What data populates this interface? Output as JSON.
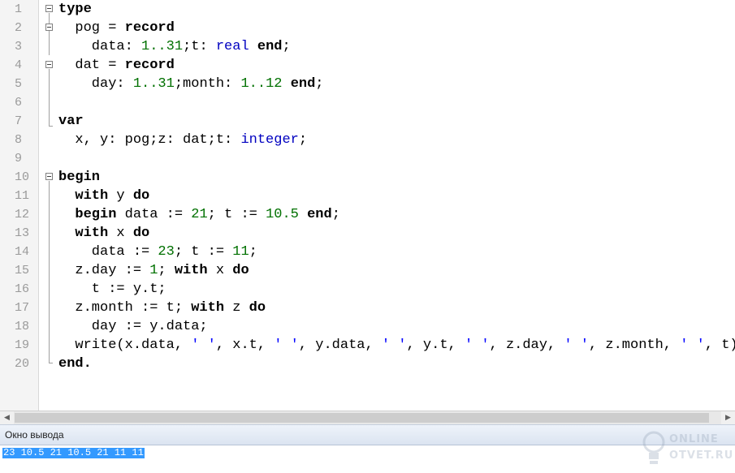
{
  "editor": {
    "line_numbers": [
      "1",
      "2",
      "3",
      "4",
      "5",
      "6",
      "7",
      "8",
      "9",
      "10",
      "11",
      "12",
      "13",
      "14",
      "15",
      "16",
      "17",
      "18",
      "19",
      "20"
    ],
    "lines": [
      [
        {
          "t": "type",
          "c": "kw"
        }
      ],
      [
        {
          "t": "  pog = "
        },
        {
          "t": "record",
          "c": "kw"
        }
      ],
      [
        {
          "t": "    data: "
        },
        {
          "t": "1..31",
          "c": "num"
        },
        {
          "t": ";t: "
        },
        {
          "t": "real",
          "c": "ty"
        },
        {
          "t": " "
        },
        {
          "t": "end",
          "c": "kw"
        },
        {
          "t": ";"
        }
      ],
      [
        {
          "t": "  dat = "
        },
        {
          "t": "record",
          "c": "kw"
        }
      ],
      [
        {
          "t": "    day: "
        },
        {
          "t": "1..31",
          "c": "num"
        },
        {
          "t": ";month: "
        },
        {
          "t": "1..12",
          "c": "num"
        },
        {
          "t": " "
        },
        {
          "t": "end",
          "c": "kw"
        },
        {
          "t": ";"
        }
      ],
      [],
      [
        {
          "t": "var",
          "c": "kw"
        }
      ],
      [
        {
          "t": "  x, y: pog;z: dat;t: "
        },
        {
          "t": "integer",
          "c": "ty"
        },
        {
          "t": ";"
        }
      ],
      [],
      [
        {
          "t": "begin",
          "c": "kw"
        }
      ],
      [
        {
          "t": "  "
        },
        {
          "t": "with",
          "c": "kw"
        },
        {
          "t": " y "
        },
        {
          "t": "do",
          "c": "kw"
        }
      ],
      [
        {
          "t": "  "
        },
        {
          "t": "begin",
          "c": "kw"
        },
        {
          "t": " data := "
        },
        {
          "t": "21",
          "c": "num"
        },
        {
          "t": "; t := "
        },
        {
          "t": "10.5",
          "c": "num"
        },
        {
          "t": " "
        },
        {
          "t": "end",
          "c": "kw"
        },
        {
          "t": ";"
        }
      ],
      [
        {
          "t": "  "
        },
        {
          "t": "with",
          "c": "kw"
        },
        {
          "t": " x "
        },
        {
          "t": "do",
          "c": "kw"
        }
      ],
      [
        {
          "t": "    data := "
        },
        {
          "t": "23",
          "c": "num"
        },
        {
          "t": "; t := "
        },
        {
          "t": "11",
          "c": "num"
        },
        {
          "t": ";"
        }
      ],
      [
        {
          "t": "  z.day := "
        },
        {
          "t": "1",
          "c": "num"
        },
        {
          "t": "; "
        },
        {
          "t": "with",
          "c": "kw"
        },
        {
          "t": " x "
        },
        {
          "t": "do",
          "c": "kw"
        }
      ],
      [
        {
          "t": "    t := y.t;"
        }
      ],
      [
        {
          "t": "  z.month := t; "
        },
        {
          "t": "with",
          "c": "kw"
        },
        {
          "t": " z "
        },
        {
          "t": "do",
          "c": "kw"
        }
      ],
      [
        {
          "t": "    day := y.data;"
        }
      ],
      [
        {
          "t": "  write(x.data, "
        },
        {
          "t": "' '",
          "c": "str"
        },
        {
          "t": ", x.t, "
        },
        {
          "t": "' '",
          "c": "str"
        },
        {
          "t": ", y.data, "
        },
        {
          "t": "' '",
          "c": "str"
        },
        {
          "t": ", y.t, "
        },
        {
          "t": "' '",
          "c": "str"
        },
        {
          "t": ", z.day, "
        },
        {
          "t": "' '",
          "c": "str"
        },
        {
          "t": ", z.month, "
        },
        {
          "t": "' '",
          "c": "str"
        },
        {
          "t": ", t);"
        }
      ],
      [
        {
          "t": "end.",
          "c": "kw"
        }
      ]
    ],
    "colors": {
      "keyword": "#000000",
      "number": "#007000",
      "type": "#0000c0",
      "string": "#0000ff",
      "line_number": "#9a9a9a"
    }
  },
  "output_panel": {
    "title": "Окно вывода",
    "text": "23 10.5 21 10.5 21 11 11"
  },
  "watermark": {
    "line1": "ONLINE",
    "line2": "OTVET.RU"
  },
  "icons": {
    "fold": "minus-box-icon",
    "scroll_left": "arrow-left-icon",
    "scroll_right": "arrow-right-icon",
    "watermark": "lightbulb-icon"
  }
}
